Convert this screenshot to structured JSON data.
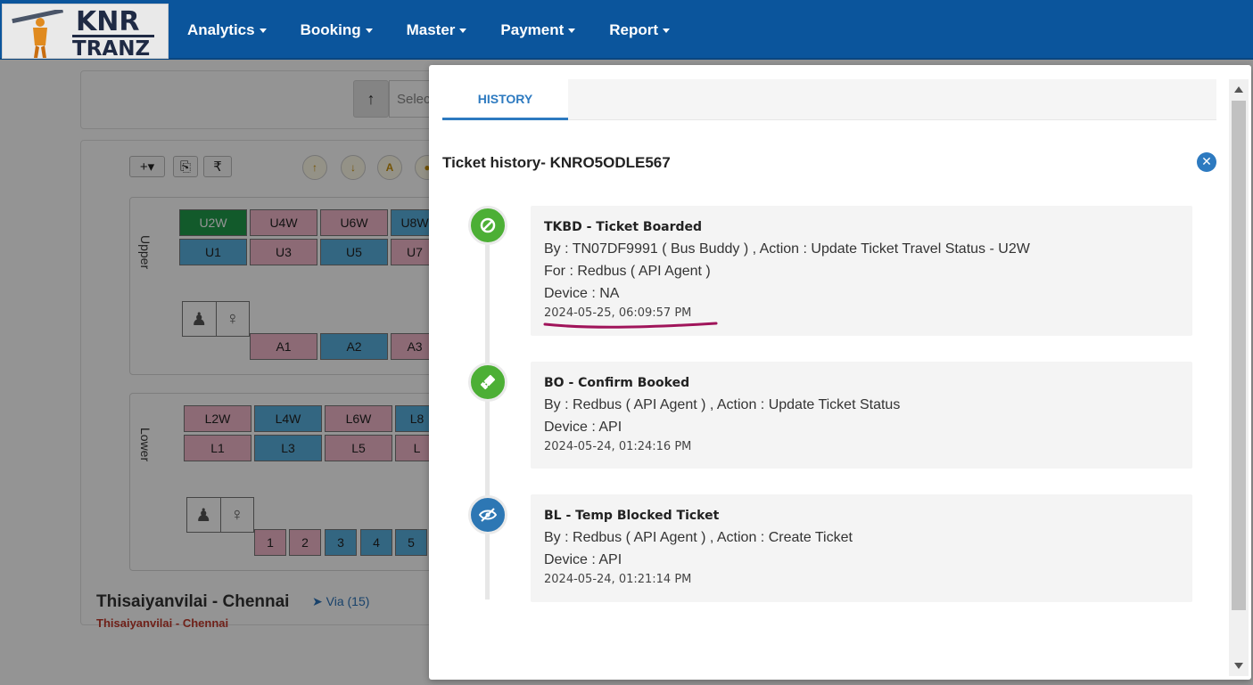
{
  "brand": {
    "line1": "KNR",
    "line2": "TRANZ"
  },
  "nav": {
    "items": [
      {
        "label": "Analytics"
      },
      {
        "label": "Booking"
      },
      {
        "label": "Master"
      },
      {
        "label": "Payment"
      },
      {
        "label": "Report"
      }
    ]
  },
  "background": {
    "select_placeholder": "Selec",
    "upper_label": "Upper",
    "lower_label": "Lower",
    "upper_seats": [
      "U2W",
      "U4W",
      "U6W",
      "U8W",
      "U1",
      "U3",
      "U5",
      "U7",
      "A1",
      "A2",
      "A3"
    ],
    "lower_seats": [
      "L2W",
      "L4W",
      "L6W",
      "L8",
      "L1",
      "L3",
      "L5",
      "L",
      "1",
      "2",
      "3",
      "4",
      "5"
    ],
    "route_title": "Thisaiyanvilai - Chennai",
    "route_sub": "Thisaiyanvilai - Chennai",
    "via": "Via (15)"
  },
  "modal": {
    "tab": "HISTORY",
    "title": "Ticket history- KNRO5ODLE567",
    "events": [
      {
        "title": "TKBD - Ticket Boarded",
        "lines": [
          "By : TN07DF9991 ( Bus Buddy ) , Action : Update Ticket Travel Status - U2W",
          "For : Redbus ( API Agent )",
          "Device : NA"
        ],
        "time": "2024-05-25, 06:09:57 PM",
        "icon": "ban-icon",
        "color": "#4caf35"
      },
      {
        "title": "BO - Confirm Booked",
        "lines": [
          "By : Redbus ( API Agent ) , Action : Update Ticket Status",
          "Device : API"
        ],
        "time": "2024-05-24, 01:24:16 PM",
        "icon": "ticket-icon",
        "color": "#4caf35"
      },
      {
        "title": "BL - Temp Blocked Ticket",
        "lines": [
          "By : Redbus ( API Agent ) , Action : Create Ticket",
          "Device : API"
        ],
        "time": "2024-05-24, 01:21:14 PM",
        "icon": "eye-slash-icon",
        "color": "#2d77b4"
      }
    ]
  },
  "colors": {
    "nav": "#0b559c",
    "accent": "#2d7ac0",
    "annotation": "#a0145a"
  }
}
